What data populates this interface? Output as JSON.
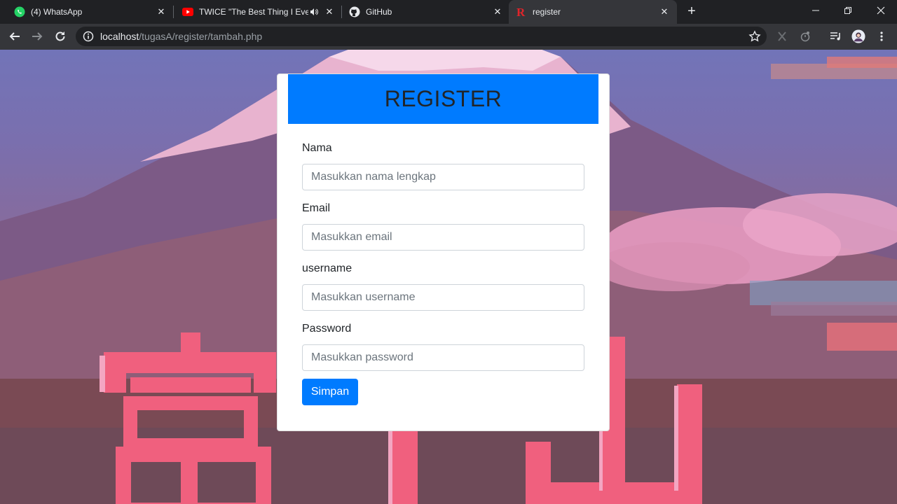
{
  "browser": {
    "tabs": [
      {
        "title": "(4) WhatsApp",
        "icon": "whatsapp-icon"
      },
      {
        "title": "TWICE \"The Best Thing I Ever",
        "icon": "youtube-icon"
      },
      {
        "title": "GitHub",
        "icon": "github-icon"
      },
      {
        "title": "register",
        "icon": "register-r-icon"
      }
    ],
    "address": {
      "host": "localhost",
      "path": "/tugasA/register/tambah.php"
    }
  },
  "form": {
    "title": "REGISTER",
    "fields": [
      {
        "label": "Nama",
        "placeholder": "Masukkan nama lengkap"
      },
      {
        "label": "Email",
        "placeholder": "Masukkan email"
      },
      {
        "label": "username",
        "placeholder": "Masukkan username"
      },
      {
        "label": "Password",
        "placeholder": "Masukkan password"
      }
    ],
    "submit_label": "Simpan"
  },
  "colors": {
    "primary": "#007bff",
    "browser_dark": "#202124",
    "browser_toolbar": "#35363a"
  }
}
